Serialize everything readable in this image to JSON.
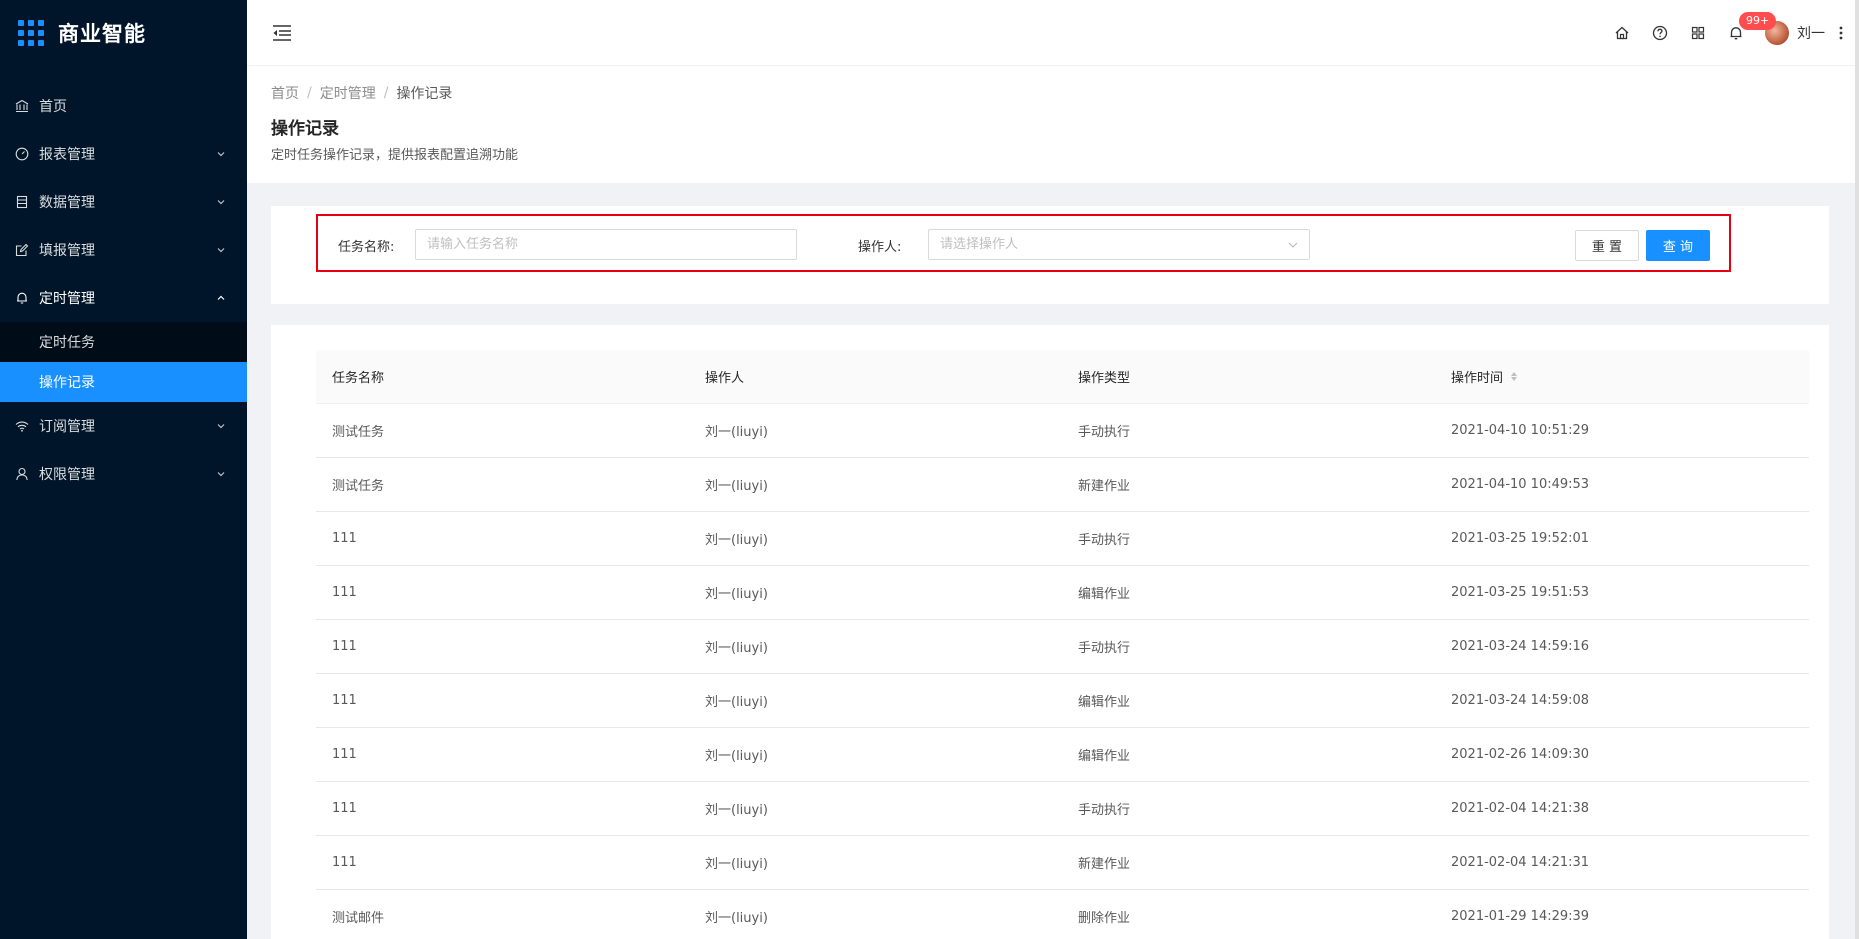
{
  "sidebar": {
    "title": "商业智能",
    "menu": [
      {
        "label": "首页",
        "icon": "bank-icon"
      },
      {
        "label": "报表管理",
        "icon": "dashboard-icon"
      },
      {
        "label": "数据管理",
        "icon": "database-icon"
      },
      {
        "label": "填报管理",
        "icon": "edit-icon"
      },
      {
        "label": "定时管理",
        "icon": "bell-icon"
      },
      {
        "label": "订阅管理",
        "icon": "wifi-icon"
      },
      {
        "label": "权限管理",
        "icon": "user-icon"
      }
    ],
    "submenu": [
      {
        "label": "定时任务"
      },
      {
        "label": "操作记录"
      }
    ]
  },
  "header": {
    "badge": "99+",
    "username": "刘一"
  },
  "page": {
    "breadcrumb": [
      "首页",
      "定时管理",
      "操作记录"
    ],
    "title": "操作记录",
    "description": "定时任务操作记录，提供报表配置追溯功能"
  },
  "filter": {
    "task_label": "任务名称:",
    "task_placeholder": "请输入任务名称",
    "operator_label": "操作人:",
    "operator_placeholder": "请选择操作人",
    "reset_label": "重 置",
    "query_label": "查 询"
  },
  "table": {
    "columns": [
      "任务名称",
      "操作人",
      "操作类型",
      "操作时间"
    ],
    "rows": [
      [
        "测试任务",
        "刘一(liuyi)",
        "手动执行",
        "2021-04-10 10:51:29"
      ],
      [
        "测试任务",
        "刘一(liuyi)",
        "新建作业",
        "2021-04-10 10:49:53"
      ],
      [
        "111",
        "刘一(liuyi)",
        "手动执行",
        "2021-03-25 19:52:01"
      ],
      [
        "111",
        "刘一(liuyi)",
        "编辑作业",
        "2021-03-25 19:51:53"
      ],
      [
        "111",
        "刘一(liuyi)",
        "手动执行",
        "2021-03-24 14:59:16"
      ],
      [
        "111",
        "刘一(liuyi)",
        "编辑作业",
        "2021-03-24 14:59:08"
      ],
      [
        "111",
        "刘一(liuyi)",
        "编辑作业",
        "2021-02-26 14:09:30"
      ],
      [
        "111",
        "刘一(liuyi)",
        "手动执行",
        "2021-02-04 14:21:38"
      ],
      [
        "111",
        "刘一(liuyi)",
        "新建作业",
        "2021-02-04 14:21:31"
      ],
      [
        "测试邮件",
        "刘一(liuyi)",
        "删除作业",
        "2021-01-29 14:29:39"
      ]
    ]
  },
  "colors": {
    "sidebar_bg": "#001529",
    "primary": "#1890ff",
    "highlight_border": "#e60012",
    "badge": "#ff4d4f"
  }
}
